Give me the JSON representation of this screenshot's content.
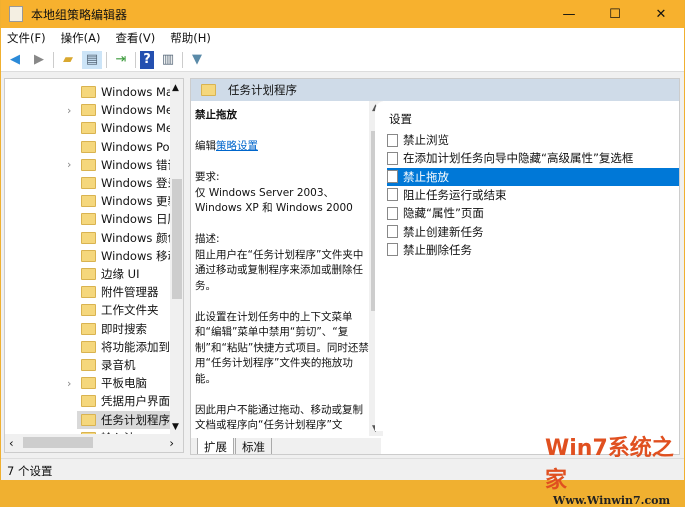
{
  "window": {
    "title": "本地组策略编辑器",
    "minimize": "—",
    "maximize": "☐",
    "close": "✕"
  },
  "menu": [
    "文件(F)",
    "操作(A)",
    "查看(V)",
    "帮助(H)"
  ],
  "tree": [
    {
      "label": "Windows Mai",
      "expand": false
    },
    {
      "label": "Windows Mec",
      "expand": true
    },
    {
      "label": "Windows Mes",
      "expand": false
    },
    {
      "label": "Windows Pow",
      "expand": false
    },
    {
      "label": "Windows 错误",
      "expand": true
    },
    {
      "label": "Windows 登录",
      "expand": false
    },
    {
      "label": "Windows 更新",
      "expand": false
    },
    {
      "label": "Windows 日历",
      "expand": false
    },
    {
      "label": "Windows 颜色",
      "expand": false
    },
    {
      "label": "Windows 移动",
      "expand": false
    },
    {
      "label": "边缘 UI",
      "expand": false
    },
    {
      "label": "附件管理器",
      "expand": false
    },
    {
      "label": "工作文件夹",
      "expand": false
    },
    {
      "label": "即时搜索",
      "expand": false
    },
    {
      "label": "将功能添加到 W",
      "expand": false
    },
    {
      "label": "录音机",
      "expand": false
    },
    {
      "label": "平板电脑",
      "expand": true
    },
    {
      "label": "凭据用户界面",
      "expand": false
    },
    {
      "label": "任务计划程序",
      "expand": false,
      "selected": true
    },
    {
      "label": "输入法",
      "expand": false
    }
  ],
  "right": {
    "header": "任务计划程序",
    "desc": {
      "title": "禁止拖放",
      "edit_prefix": "编辑",
      "edit_link": "策略设置",
      "req_label": "要求:",
      "req_text": "仅 Windows Server 2003、Windows XP 和 Windows 2000",
      "desc_label": "描述:",
      "p1": "阻止用户在“任务计划程序”文件夹中通过移动或复制程序来添加或删除任务。",
      "p2": "此设置在计划任务中的上下文菜单和“编辑”菜单中禁用“剪切”、“复制”和“粘贴”快捷方式项目。同时还禁用“任务计划程序”文件夹的拖放功能。",
      "p3": "因此用户不能通过拖动、移动或复制文档或程序向“任务计划程序”文"
    },
    "list_header": "设置",
    "items": [
      "禁止浏览",
      "在添加计划任务向导中隐藏“高级属性”复选框",
      "禁止拖放",
      "阻止任务运行或结束",
      "隐藏“属性”页面",
      "禁止创建新任务",
      "禁止删除任务"
    ],
    "tabs": [
      "扩展",
      "标准"
    ]
  },
  "status": "7 个设置",
  "watermark": {
    "brand": "Win7系统之家",
    "url": "Www.Winwin7.com"
  }
}
